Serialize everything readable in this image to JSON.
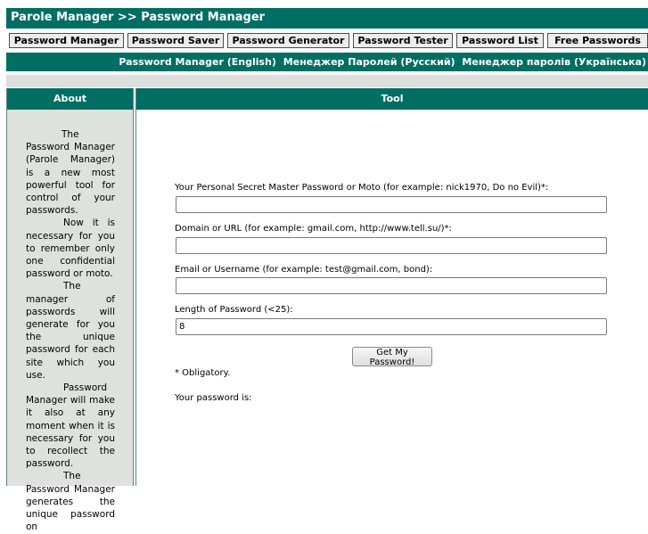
{
  "header": {
    "title": "Parole Manager >> Password Manager"
  },
  "nav": {
    "items": [
      {
        "label": "Password Manager"
      },
      {
        "label": "Password Saver"
      },
      {
        "label": "Password Generator"
      },
      {
        "label": "Password Tester"
      },
      {
        "label": "Password List"
      },
      {
        "label": "Free Passwords"
      }
    ]
  },
  "languages": [
    {
      "label": "Password Manager (English)"
    },
    {
      "label": "Менеджер Паролей (Русский)"
    },
    {
      "label": "Менеджер паролів (Українська)"
    }
  ],
  "sidebar": {
    "heading": "About",
    "paragraphs": [
      "The Password Manager (Parole Manager) is a new most powerful tool for control of your passwords.",
      "Now it is necessary for you to remember only one confidential password or moto.",
      "The manager of passwords will generate for you the unique password for each site which you use.",
      "Password Manager will make it also at any moment when it is necessary for you to recollect the password.",
      "The Password Manager generates the unique password on"
    ]
  },
  "tool": {
    "heading": "Tool",
    "fields": [
      {
        "label": "Your Personal Secret Master Password or Moto (for example: nick1970, Do no Evil)*:",
        "value": ""
      },
      {
        "label": "Domain or URL (for example: gmail.com, http://www.tell.su/)*:",
        "value": ""
      },
      {
        "label": "Email or Username (for example: test@gmail.com, bond):",
        "value": ""
      },
      {
        "label": "Length of Password (<25):",
        "value": "8"
      }
    ],
    "submit_label": "Get My Password!",
    "note": "* Obligatory.",
    "result_label": "Your password is:"
  }
}
